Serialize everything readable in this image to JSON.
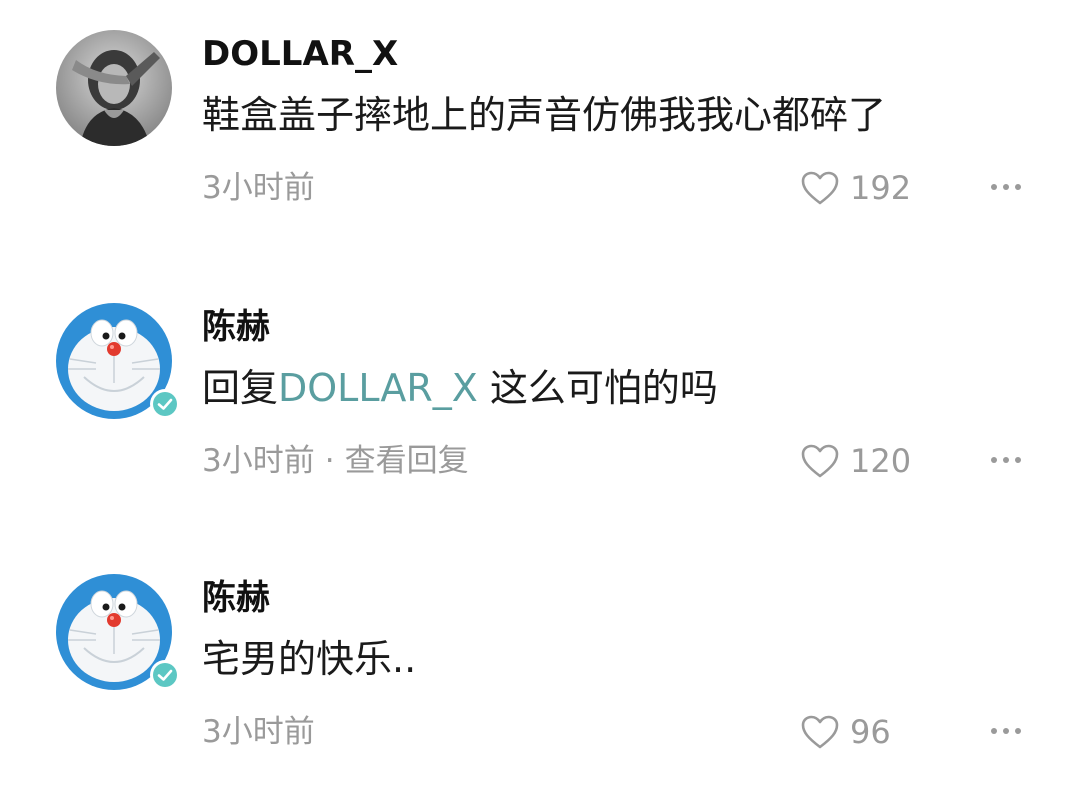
{
  "comments": [
    {
      "username": "DOLLAR_X",
      "text": "鞋盒盖子摔地上的声音仿佛我我心都碎了",
      "time": "3小时前",
      "likes": "192",
      "avatar": "mona-lisa-dab-avatar",
      "verified": false
    },
    {
      "username": "陈赫",
      "reply_prefix": "回复",
      "mention": "DOLLAR_X",
      "text": " 这么可怕的吗",
      "time": "3小时前",
      "separator": "·",
      "view_replies": "查看回复",
      "likes": "120",
      "avatar": "doraemon-avatar",
      "verified": true
    },
    {
      "username": "陈赫",
      "text": "宅男的快乐..",
      "time": "3小时前",
      "likes": "96",
      "avatar": "doraemon-avatar",
      "verified": true
    }
  ],
  "icons": {
    "like": "heart-outline-icon",
    "more": "more-dots-icon",
    "verified": "verified-check-icon"
  },
  "colors": {
    "mention": "#5a9ea0",
    "meta": "#9a9a9a",
    "verified_badge": "#5cc7c3",
    "doraemon_blue": "#2f8fd6"
  }
}
